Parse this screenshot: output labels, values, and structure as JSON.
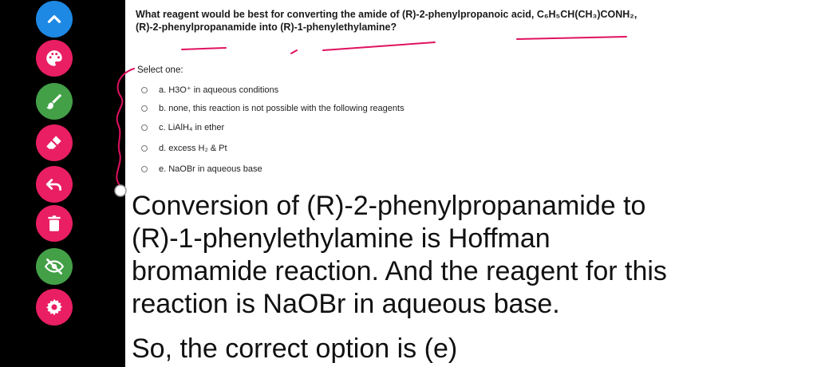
{
  "toolbar": {
    "tools": [
      {
        "name": "collapse",
        "icon": "chevron-up-icon",
        "color": "#1e88e5"
      },
      {
        "name": "color",
        "icon": "palette-icon",
        "color": "#e91e63"
      },
      {
        "name": "pen",
        "icon": "brush-icon",
        "color": "#43a047"
      },
      {
        "name": "eraser",
        "icon": "eraser-icon",
        "color": "#e91e63"
      },
      {
        "name": "undo",
        "icon": "undo-icon",
        "color": "#e91e63"
      },
      {
        "name": "delete",
        "icon": "trash-icon",
        "color": "#e91e63"
      },
      {
        "name": "hide",
        "icon": "eye-off-icon",
        "color": "#43a047"
      },
      {
        "name": "settings",
        "icon": "gear-icon",
        "color": "#e91e63"
      }
    ]
  },
  "question": {
    "line1": "What reagent would be best for converting the amide of (R)-2-phenylpropanoic acid, C₆H₅CH(CH₃)CONH₂,",
    "line2": "(R)-2-phenylpropanamide into (R)-1-phenylethylamine?"
  },
  "select_label": "Select one:",
  "options": [
    "a. H3O⁺ in aqueous conditions",
    "b. none, this reaction is not possible with the following reagents",
    "c. LiAlH₄ in ether",
    "d. excess H₂ & Pt",
    "e. NaOBr in aqueous base"
  ],
  "answer": {
    "text": "Conversion of (R)-2-phenylpropanamide to (R)-1-phenylethylamine is Hoffman bromamide reaction. And the reagent for this reaction is NaOBr in aqueous base.",
    "conclusion": "So, the correct option is (e)"
  },
  "ink_color": "#e0115f"
}
